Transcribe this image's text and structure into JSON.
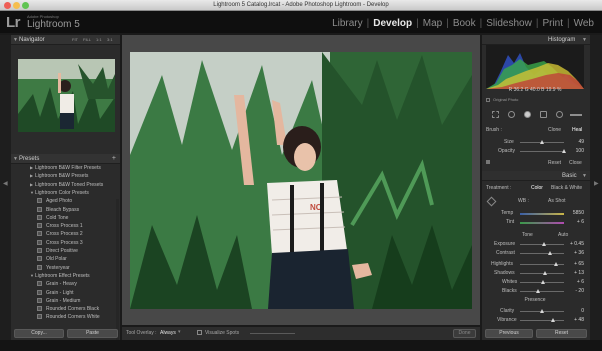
{
  "window": {
    "title": "Lightroom 5 Catalog.lrcat - Adobe Photoshop Lightroom - Develop"
  },
  "brand": {
    "logo": "Lr",
    "small": "Adobe Photoshop",
    "large": "Lightroom 5"
  },
  "modules": [
    {
      "label": "Library",
      "active": false
    },
    {
      "label": "Develop",
      "active": true
    },
    {
      "label": "Map",
      "active": false
    },
    {
      "label": "Book",
      "active": false
    },
    {
      "label": "Slideshow",
      "active": false
    },
    {
      "label": "Print",
      "active": false
    },
    {
      "label": "Web",
      "active": false
    }
  ],
  "navigator": {
    "title": "Navigator",
    "zoom": [
      "FIT",
      "FILL",
      "1:1",
      "3:1"
    ]
  },
  "presets": {
    "title": "Presets",
    "add": "+",
    "items": [
      {
        "type": "folder",
        "label": "Lightroom B&W Filter Presets"
      },
      {
        "type": "folder",
        "label": "Lightroom B&W Presets"
      },
      {
        "type": "folder",
        "label": "Lightroom B&W Toned Presets"
      },
      {
        "type": "folder",
        "label": "Lightroom Color Presets"
      },
      {
        "type": "preset",
        "label": "Aged Photo"
      },
      {
        "type": "preset",
        "label": "Bleach Bypass"
      },
      {
        "type": "preset",
        "label": "Cold Tone"
      },
      {
        "type": "preset",
        "label": "Cross Process 1"
      },
      {
        "type": "preset",
        "label": "Cross Process 2"
      },
      {
        "type": "preset",
        "label": "Cross Process 3"
      },
      {
        "type": "preset",
        "label": "Direct Positive"
      },
      {
        "type": "preset",
        "label": "Old Polar"
      },
      {
        "type": "preset",
        "label": "Yesteryear"
      },
      {
        "type": "folder",
        "label": "Lightroom Effect Presets"
      },
      {
        "type": "preset",
        "label": "Grain - Heavy"
      },
      {
        "type": "preset",
        "label": "Grain - Light"
      },
      {
        "type": "preset",
        "label": "Grain - Medium"
      },
      {
        "type": "preset",
        "label": "Rounded Corners Black"
      },
      {
        "type": "preset",
        "label": "Rounded Corners White"
      }
    ]
  },
  "leftbuttons": {
    "copy": "Copy...",
    "paste": "Paste"
  },
  "toolbar": {
    "tool_overlay_label": "Tool Overlay :",
    "tool_overlay_value": "Always",
    "visualize_spots": "Visualize Spots",
    "done": "Done"
  },
  "histogram": {
    "title": "Histogram",
    "readout": "R  36.2  G  40.0  B  19.9 %",
    "original_photo": "Original Photo"
  },
  "brush": {
    "label": "Brush :",
    "clone": "Clone",
    "heal": "Heal",
    "size_label": "Size",
    "size_value": "49",
    "size_fraction": 0.49,
    "opacity_label": "Opacity",
    "opacity_value": "100",
    "opacity_fraction": 1.0,
    "reset": "Reset",
    "close": "Close"
  },
  "basic": {
    "title": "Basic",
    "treatment_label": "Treatment :",
    "color": "Color",
    "bw": "Black & White",
    "wb_label": "WB :",
    "wb_value": "As Shot",
    "temp_label": "Temp",
    "temp_value": "5850",
    "tint_label": "Tint",
    "tint_value": "+ 6",
    "tone_label": "Tone",
    "auto": "Auto",
    "sliders": [
      {
        "label": "Exposure",
        "value": "+ 0.45",
        "position": 0.54
      },
      {
        "label": "Contrast",
        "value": "+ 36",
        "position": 0.68
      },
      {
        "label": "Highlights",
        "value": "+ 65",
        "position": 0.82
      },
      {
        "label": "Shadows",
        "value": "+ 13",
        "position": 0.56
      },
      {
        "label": "Whites",
        "value": "+ 6",
        "position": 0.53
      },
      {
        "label": "Blacks",
        "value": "- 20",
        "position": 0.4
      }
    ],
    "presence_label": "Presence",
    "clarity_label": "Clarity",
    "clarity_value": "0",
    "clarity_position": 0.5,
    "vibrance_label": "Vibrance",
    "vibrance_value": "+ 48",
    "vibrance_position": 0.74
  },
  "rightbuttons": {
    "previous": "Previous",
    "reset": "Reset"
  },
  "colors": {
    "accent": "#e8e8e8",
    "panel": "#2b2b2b",
    "center": "#484848"
  }
}
